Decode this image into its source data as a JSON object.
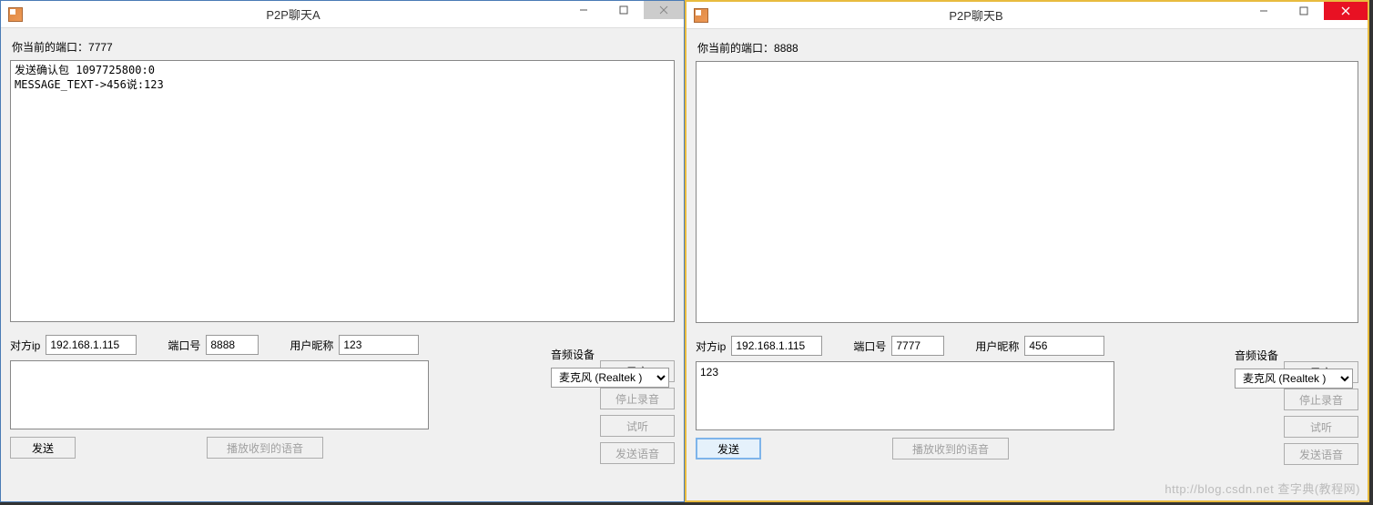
{
  "windows": [
    {
      "id": "a",
      "active": false,
      "title": "P2P聊天A",
      "port_label": "你当前的端口：",
      "port_value": "7777",
      "log": "发送确认包 1097725800:0\nMESSAGE_TEXT->456说:123",
      "fields": {
        "ip_label": "对方ip",
        "ip_value": "192.168.1.115",
        "port_label": "端口号",
        "port_value": "8888",
        "nick_label": "用户昵称",
        "nick_value": "123"
      },
      "message_value": "",
      "buttons": {
        "send": "发送",
        "play_received": "播放收到的语音",
        "record": "录音",
        "stop_record": "停止录音",
        "preview": "试听",
        "send_voice": "发送语音"
      },
      "audio": {
        "label": "音频设备",
        "selected": "麦克风 (Realtek )"
      },
      "close_style": "inactive"
    },
    {
      "id": "b",
      "active": true,
      "title": "P2P聊天B",
      "port_label": "你当前的端口：",
      "port_value": "8888",
      "log": "",
      "fields": {
        "ip_label": "对方ip",
        "ip_value": "192.168.1.115",
        "port_label": "端口号",
        "port_value": "7777",
        "nick_label": "用户昵称",
        "nick_value": "456"
      },
      "message_value": "123",
      "buttons": {
        "send": "发送",
        "play_received": "播放收到的语音",
        "record": "录音",
        "stop_record": "停止录音",
        "preview": "试听",
        "send_voice": "发送语音"
      },
      "audio": {
        "label": "音频设备",
        "selected": "麦克风 (Realtek )"
      },
      "close_style": "active"
    }
  ],
  "watermark": "http://blog.csdn.net  查字典(教程网)"
}
